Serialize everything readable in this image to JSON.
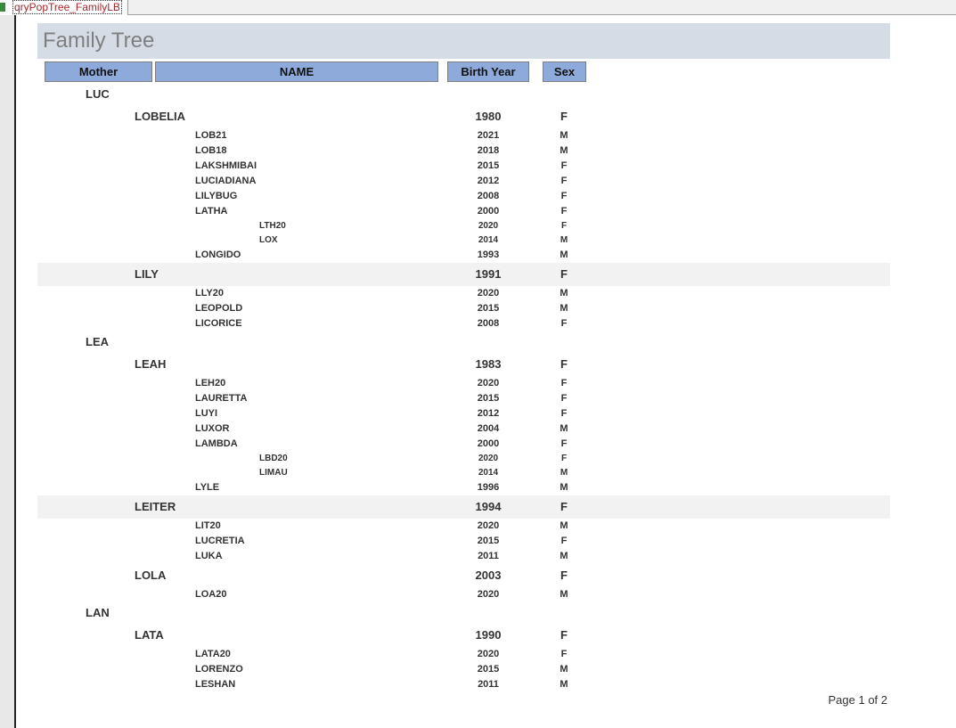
{
  "tab": {
    "title": "qryPopTree_FamilyLB"
  },
  "report": {
    "title": "Family Tree",
    "footer": "Page 1 of 2"
  },
  "headers": {
    "mother": "Mother",
    "name": "NAME",
    "birth_year": "Birth Year",
    "sex": "Sex"
  },
  "colors": {
    "header_bg": "#8eaadb",
    "banner_bg": "#d6dce5",
    "band_bg": "#f2f2f2"
  },
  "rows": [
    {
      "type": "mother",
      "name": "LUC"
    },
    {
      "type": "daughter",
      "name": "LOBELIA",
      "year": "1980",
      "sex": "F"
    },
    {
      "type": "child",
      "name": "LOB21",
      "year": "2021",
      "sex": "M"
    },
    {
      "type": "child",
      "name": "LOB18",
      "year": "2018",
      "sex": "M"
    },
    {
      "type": "child",
      "name": "LAKSHMIBAI",
      "year": "2015",
      "sex": "F"
    },
    {
      "type": "child",
      "name": "LUCIADIANA",
      "year": "2012",
      "sex": "F"
    },
    {
      "type": "child",
      "name": "LILYBUG",
      "year": "2008",
      "sex": "F"
    },
    {
      "type": "child",
      "name": "LATHA",
      "year": "2000",
      "sex": "F"
    },
    {
      "type": "grand",
      "name": "LTH20",
      "year": "2020",
      "sex": "F"
    },
    {
      "type": "grand",
      "name": "LOX",
      "year": "2014",
      "sex": "M"
    },
    {
      "type": "child",
      "name": "LONGIDO",
      "year": "1993",
      "sex": "M"
    },
    {
      "type": "daughter",
      "name": "LILY",
      "year": "1991",
      "sex": "F",
      "band": true
    },
    {
      "type": "child",
      "name": "LLY20",
      "year": "2020",
      "sex": "M"
    },
    {
      "type": "child",
      "name": "LEOPOLD",
      "year": "2015",
      "sex": "M"
    },
    {
      "type": "child",
      "name": "LICORICE",
      "year": "2008",
      "sex": "F"
    },
    {
      "type": "mother",
      "name": "LEA"
    },
    {
      "type": "daughter",
      "name": "LEAH",
      "year": "1983",
      "sex": "F"
    },
    {
      "type": "child",
      "name": "LEH20",
      "year": "2020",
      "sex": "F"
    },
    {
      "type": "child",
      "name": "LAURETTA",
      "year": "2015",
      "sex": "F"
    },
    {
      "type": "child",
      "name": "LUYI",
      "year": "2012",
      "sex": "F"
    },
    {
      "type": "child",
      "name": "LUXOR",
      "year": "2004",
      "sex": "M"
    },
    {
      "type": "child",
      "name": "LAMBDA",
      "year": "2000",
      "sex": "F"
    },
    {
      "type": "grand",
      "name": "LBD20",
      "year": "2020",
      "sex": "F"
    },
    {
      "type": "grand",
      "name": "LIMAU",
      "year": "2014",
      "sex": "M"
    },
    {
      "type": "child",
      "name": "LYLE",
      "year": "1996",
      "sex": "M"
    },
    {
      "type": "daughter",
      "name": "LEITER",
      "year": "1994",
      "sex": "F",
      "band": true
    },
    {
      "type": "child",
      "name": "LIT20",
      "year": "2020",
      "sex": "M"
    },
    {
      "type": "child",
      "name": "LUCRETIA",
      "year": "2015",
      "sex": "F"
    },
    {
      "type": "child",
      "name": "LUKA",
      "year": "2011",
      "sex": "M"
    },
    {
      "type": "daughter",
      "name": "LOLA",
      "year": "2003",
      "sex": "F"
    },
    {
      "type": "child",
      "name": "LOA20",
      "year": "2020",
      "sex": "M"
    },
    {
      "type": "mother",
      "name": "LAN"
    },
    {
      "type": "daughter",
      "name": "LATA",
      "year": "1990",
      "sex": "F"
    },
    {
      "type": "child",
      "name": "LATA20",
      "year": "2020",
      "sex": "F"
    },
    {
      "type": "child",
      "name": "LORENZO",
      "year": "2015",
      "sex": "M"
    },
    {
      "type": "child",
      "name": "LESHAN",
      "year": "2011",
      "sex": "M"
    }
  ]
}
